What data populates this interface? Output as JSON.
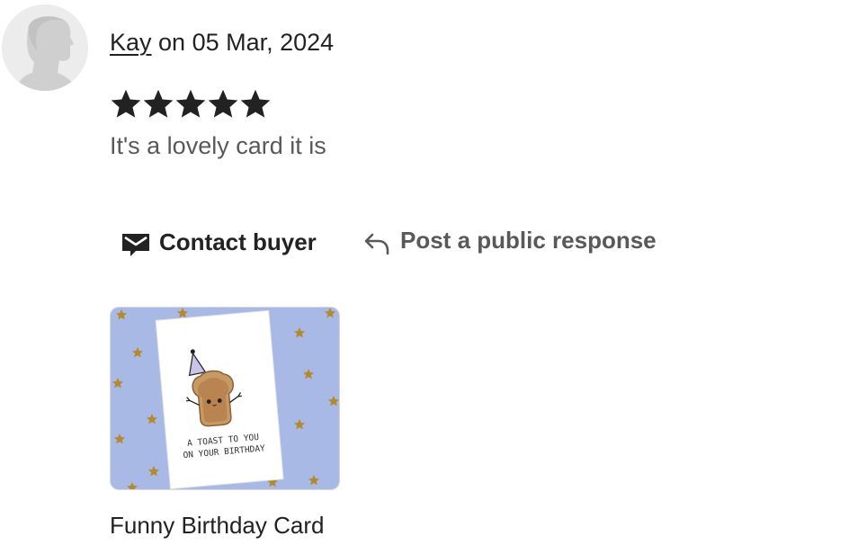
{
  "review": {
    "reviewer_name": "Kay",
    "date_text": " on 05 Mar, 2024",
    "rating": 5,
    "rating_max": 5,
    "text": "It's a lovely card it is"
  },
  "actions": {
    "contact_label": "Contact buyer",
    "contact_icon": "envelope-icon",
    "respond_label": "Post a public response",
    "respond_icon": "reply-arrow-icon"
  },
  "product": {
    "title": "Funny Birthday Card",
    "card_text_line1": "A TOAST TO YOU",
    "card_text_line2": "ON YOUR BIRTHDAY"
  },
  "colors": {
    "text": "#222222",
    "muted": "#595959",
    "thumb_background": "#a9b9e6",
    "toast": "#c89a63",
    "star_gold": "#b58a2d"
  }
}
